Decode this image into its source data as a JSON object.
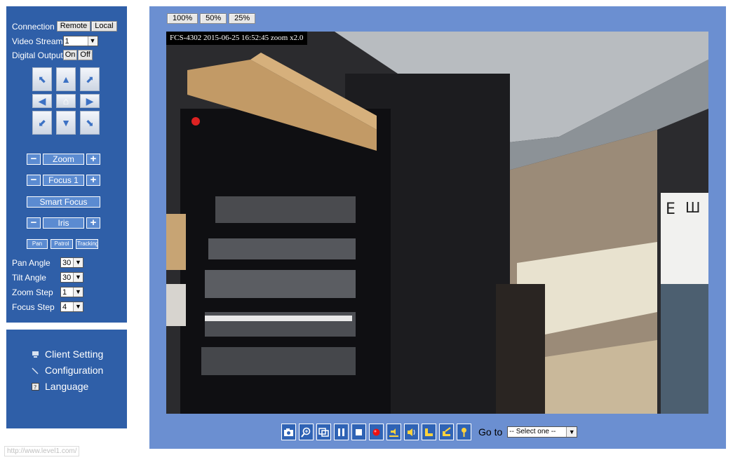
{
  "control": {
    "connection_label": "Connection",
    "remote_btn": "Remote",
    "local_btn": "Local",
    "video_stream_label": "Video Stream",
    "video_stream_value": "1",
    "digital_output_label": "Digital Output",
    "on_btn": "On",
    "off_btn": "Off",
    "zoom_label": "Zoom",
    "focus_label": "Focus 1",
    "smart_focus_label": "Smart Focus",
    "iris_label": "Iris",
    "minus": "−",
    "plus": "+",
    "pan_btn": "Pan",
    "patrol_btn": "Patrol",
    "tracking_btn": "Tracking",
    "pan_angle_label": "Pan Angle",
    "pan_angle_value": "30",
    "tilt_angle_label": "Tilt Angle",
    "tilt_angle_value": "30",
    "zoom_step_label": "Zoom Step",
    "zoom_step_value": "1",
    "focus_step_label": "Focus Step",
    "focus_step_value": "4"
  },
  "menu": {
    "client_setting": "Client Setting",
    "configuration": "Configuration",
    "language": "Language"
  },
  "status_url": "http://www.level1.com/",
  "video": {
    "zoom_100": "100%",
    "zoom_50": "50%",
    "zoom_25": "25%",
    "overlay": "FCS-4302 2015-06-25 16:52:45 zoom x2.0",
    "goto_label": "Go to",
    "goto_value": "-- Select one --"
  },
  "colors": {
    "panel": "#2f5fa8",
    "video_bg": "#6b8fd1",
    "button_blue": "#5b8bd1",
    "toolbar_blue": "#2f63b5"
  }
}
